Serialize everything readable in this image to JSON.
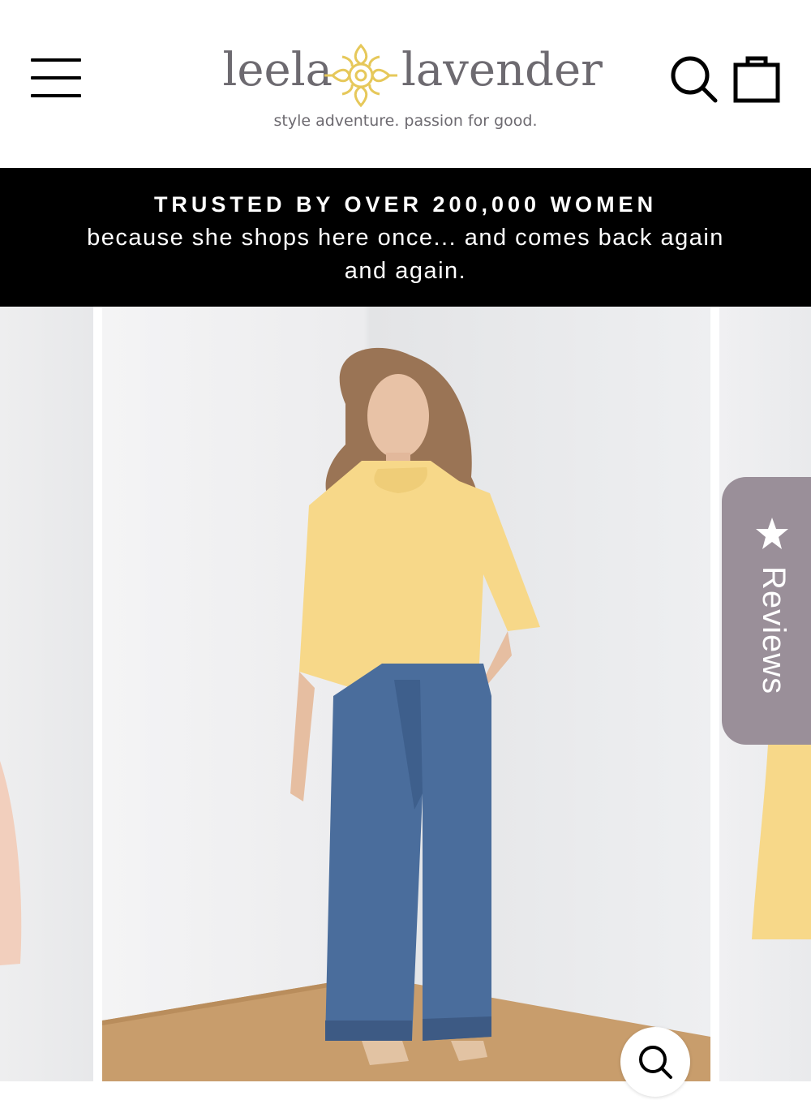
{
  "header": {
    "logo": {
      "left_word": "leela",
      "right_word": "lavender",
      "tagline": "style adventure. passion for good."
    },
    "icons": {
      "menu": "hamburger-menu-icon",
      "search": "search-icon",
      "cart": "shopping-bag-icon"
    }
  },
  "announcement": {
    "title": "TRUSTED BY OVER 200,000 WOMEN",
    "subtitle": "because she shops here once... and comes back again and again."
  },
  "gallery": {
    "zoom_icon": "zoom-search-icon",
    "colors": {
      "top": "#f7d889",
      "jeans": "#4a6d9c",
      "floor": "#c89d6c",
      "wall": "#ececee"
    }
  },
  "reviews_tab": {
    "label": "Reviews",
    "icon": "star-icon",
    "color": "#9a8f99"
  }
}
